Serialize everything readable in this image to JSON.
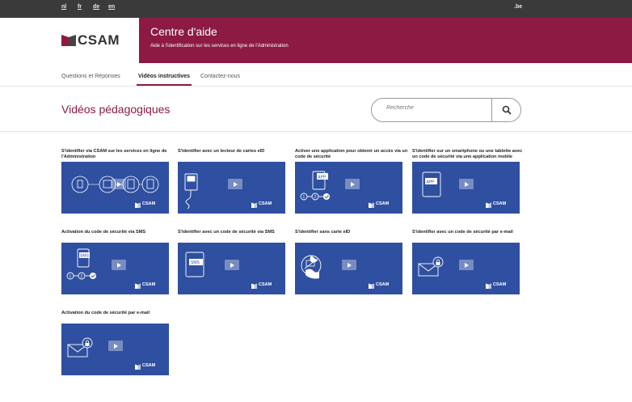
{
  "topbar": {
    "languages": [
      "nl",
      "fr",
      "de",
      "en"
    ],
    "site_suffix": ".be"
  },
  "header": {
    "logo_text": "CSAM",
    "title": "Centre d'aide",
    "subtitle": "Aide à l'identification sur les services en ligne de l'Administration"
  },
  "nav": {
    "tabs": [
      {
        "label": "Questions et Réponses",
        "active": false
      },
      {
        "label": "Vidéos instructives",
        "active": true
      },
      {
        "label": "Contactez-nous",
        "active": false
      }
    ]
  },
  "main": {
    "title": "Vidéos pédagogiques",
    "search_placeholder": "Recherche",
    "videos": [
      {
        "title": "S'identifier via CSAM sur les services en ligne de l'Administration",
        "icon": "id-methods-icon"
      },
      {
        "title": "S'identifier avec un lecteur de cartes eID",
        "icon": "card-reader-icon"
      },
      {
        "title": "Activer une application pour obtenir un accès via un code de sécurité",
        "icon": "app-activation-icon",
        "badge": "APP"
      },
      {
        "title": "S'identifier sur un smartphone ou une tablette avec un code de sécurité via une application mobile",
        "icon": "tablet-app-icon",
        "badge": "APP"
      },
      {
        "title": "Activation du code de sécurité via SMS",
        "icon": "sms-activation-icon",
        "badge": "SMS"
      },
      {
        "title": "S'identifier avec un code de sécurité via SMS",
        "icon": "sms-tablet-icon",
        "badge": "SMS"
      },
      {
        "title": "S'identifier sans carte eID",
        "icon": "no-eid-globe-icon"
      },
      {
        "title": "S'identifier avec un code de sécurité par e-mail",
        "icon": "email-lock-icon"
      },
      {
        "title": "Activation du code de sécurité par e-mail",
        "icon": "email-lock-icon"
      }
    ],
    "thumb_logo_text": "CSAM"
  },
  "colors": {
    "brand": "#8c1a43",
    "thumb_bg": "#2f4fa0",
    "topbar": "#3a3a3a"
  }
}
